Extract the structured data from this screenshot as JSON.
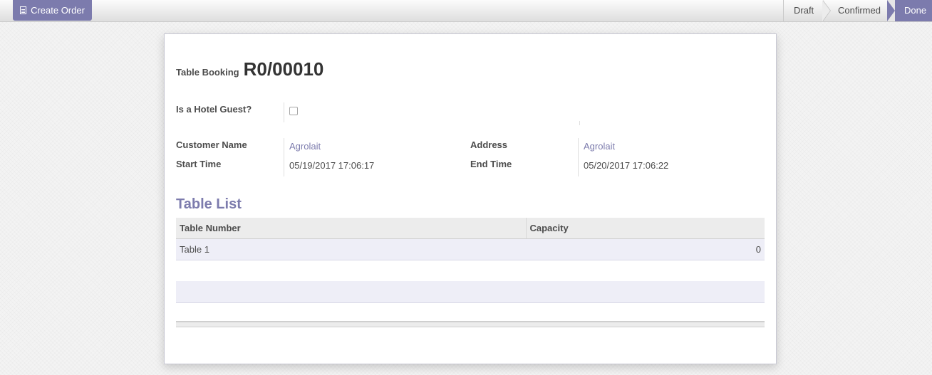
{
  "toolbar": {
    "create_order_label": "Create Order",
    "create_order_icon": "document-icon"
  },
  "stages": [
    {
      "label": "Draft",
      "active": false
    },
    {
      "label": "Confirmed",
      "active": false
    },
    {
      "label": "Done",
      "active": true
    }
  ],
  "colors": {
    "accent": "#7c7bad"
  },
  "form": {
    "title_label": "Table Booking",
    "title_value": "R0/00010",
    "hotel_guest": {
      "label": "Is a Hotel Guest?",
      "checked": false
    },
    "customer_name": {
      "label": "Customer Name",
      "value": "Agrolait"
    },
    "address": {
      "label": "Address",
      "value": "Agrolait"
    },
    "start_time": {
      "label": "Start Time",
      "value": "05/19/2017 17:06:17"
    },
    "end_time": {
      "label": "End Time",
      "value": "05/20/2017 17:06:22"
    }
  },
  "table_list": {
    "title": "Table List",
    "columns": [
      "Table Number",
      "Capacity"
    ],
    "rows": [
      {
        "table_number": "Table 1",
        "capacity": "0"
      }
    ]
  }
}
